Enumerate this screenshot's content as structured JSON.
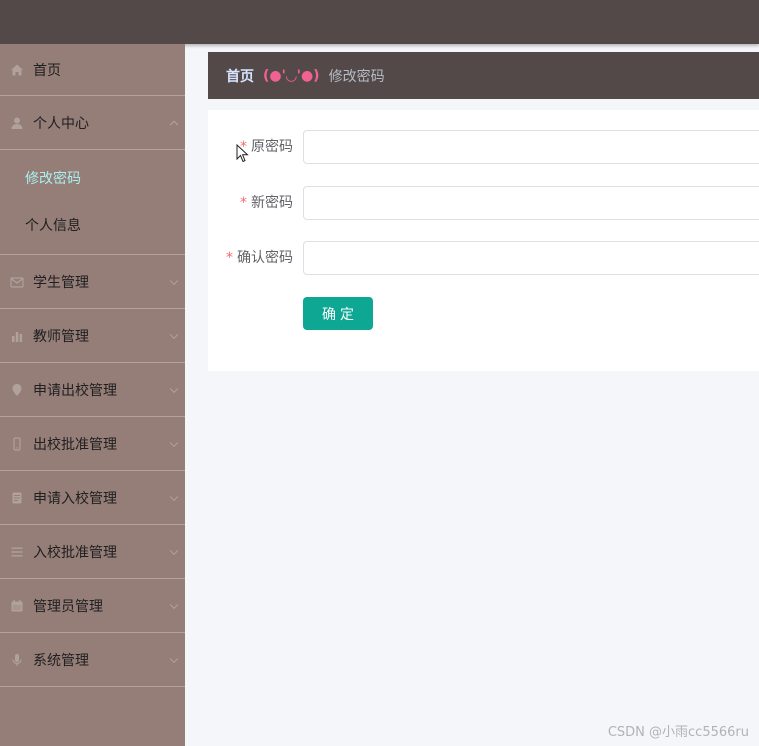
{
  "sidebar": {
    "home": "首页",
    "personal_center": "个人中心",
    "sub": {
      "change_password": "修改密码",
      "personal_info": "个人信息"
    },
    "items": [
      "学生管理",
      "教师管理",
      "申请出校管理",
      "出校批准管理",
      "申请入校管理",
      "入校批准管理",
      "管理员管理",
      "系统管理"
    ]
  },
  "breadcrumb": {
    "home": "首页",
    "separator": "(●'◡'●)",
    "current": "修改密码"
  },
  "form": {
    "old_password_label": "原密码",
    "new_password_label": "新密码",
    "confirm_password_label": "确认密码",
    "required_mark": "*",
    "submit_label": "确定"
  },
  "watermark": "CSDN @小雨cc5566ru",
  "colors": {
    "topbar": "#534949",
    "sidebar": "#957d78",
    "active_sub": "#a8f0f0",
    "accent": "#0ea793",
    "breadcrumb_sep": "#f06292"
  }
}
